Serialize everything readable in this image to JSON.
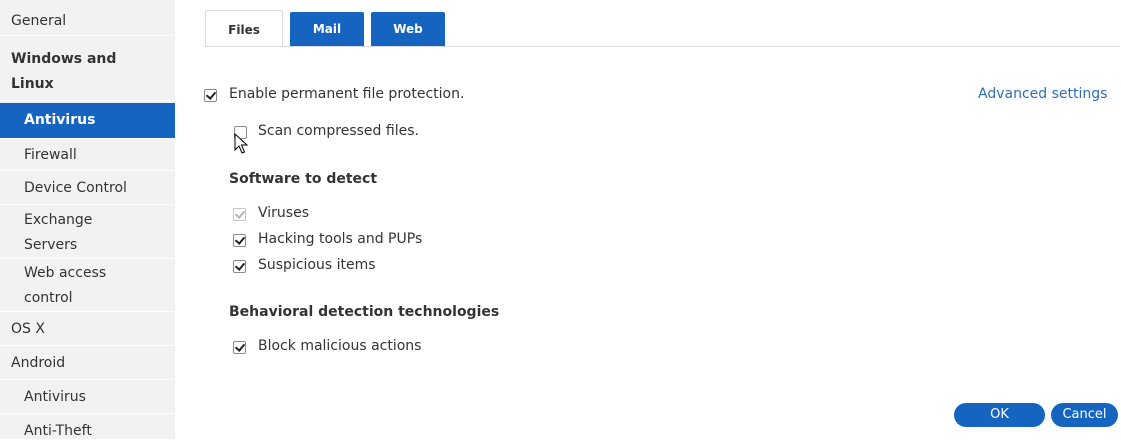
{
  "sidebar": {
    "items": [
      {
        "label": "General"
      },
      {
        "label": "Windows and Linux"
      },
      {
        "label": "Antivirus"
      },
      {
        "label": "Firewall"
      },
      {
        "label": "Device Control"
      },
      {
        "label": "Exchange Servers"
      },
      {
        "label": "Web access control"
      },
      {
        "label": "OS X"
      },
      {
        "label": "Android"
      },
      {
        "label": "Antivirus"
      },
      {
        "label": "Anti-Theft"
      }
    ]
  },
  "tabs": [
    {
      "label": "Files",
      "active": true
    },
    {
      "label": "Mail",
      "active": false
    },
    {
      "label": "Web",
      "active": false
    }
  ],
  "main": {
    "enable_protection": {
      "label": "Enable permanent file protection.",
      "checked": true
    },
    "advanced_settings": "Advanced settings",
    "scan_compressed": {
      "label": "Scan compressed files.",
      "checked": false
    },
    "software_heading": "Software to detect",
    "software": [
      {
        "label": "Viruses",
        "checked": true,
        "disabled": true
      },
      {
        "label": "Hacking tools and PUPs",
        "checked": true,
        "disabled": false
      },
      {
        "label": "Suspicious items",
        "checked": true,
        "disabled": false
      }
    ],
    "behavioral_heading": "Behavioral detection technologies",
    "block_malicious": {
      "label": "Block malicious actions",
      "checked": true
    }
  },
  "buttons": {
    "ok": "OK",
    "cancel": "Cancel"
  },
  "colors": {
    "accent": "#1565c0",
    "link": "#2f6db6",
    "sidebar_bg": "#f2f2f2"
  }
}
